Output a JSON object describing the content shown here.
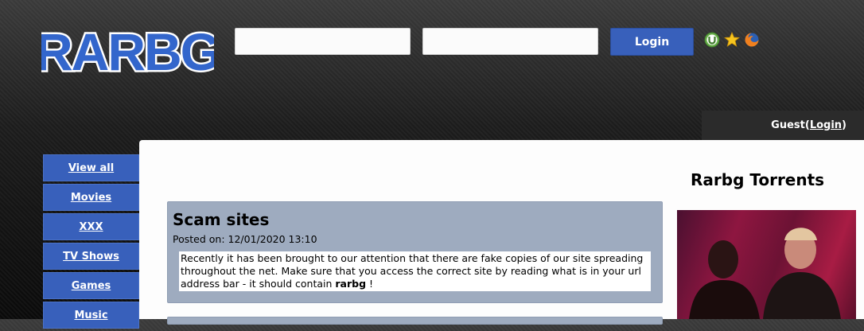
{
  "header": {
    "logo_text": "RARBG",
    "username_placeholder": "",
    "password_placeholder": "",
    "login_button": "Login",
    "icons": [
      "utorrent-icon",
      "bookmark-star-icon",
      "firefox-icon"
    ]
  },
  "user_bar": {
    "guest": "Guest",
    "open_paren": " (",
    "login_link": "Login",
    "close_paren": ")"
  },
  "nav": {
    "items": [
      {
        "label": "View all"
      },
      {
        "label": "Movies"
      },
      {
        "label": "XXX"
      },
      {
        "label": "TV Shows"
      },
      {
        "label": "Games"
      },
      {
        "label": "Music"
      }
    ]
  },
  "post": {
    "title": "Scam sites",
    "date": "Posted on: 12/01/2020 13:10",
    "body_before": "Recently it has been brought to our attention that there are fake copies of our site spreading throughout the net. Make sure that you access the correct site by reading what is in your url address bar - it should contain ",
    "body_bold": "rarbg",
    "body_after": " !"
  },
  "sidebar": {
    "title": "Rarbg Torrents"
  },
  "colors": {
    "accent_blue": "#3860bb",
    "post_panel": "#9eabbf",
    "header_dark": "#1c1c1c"
  }
}
